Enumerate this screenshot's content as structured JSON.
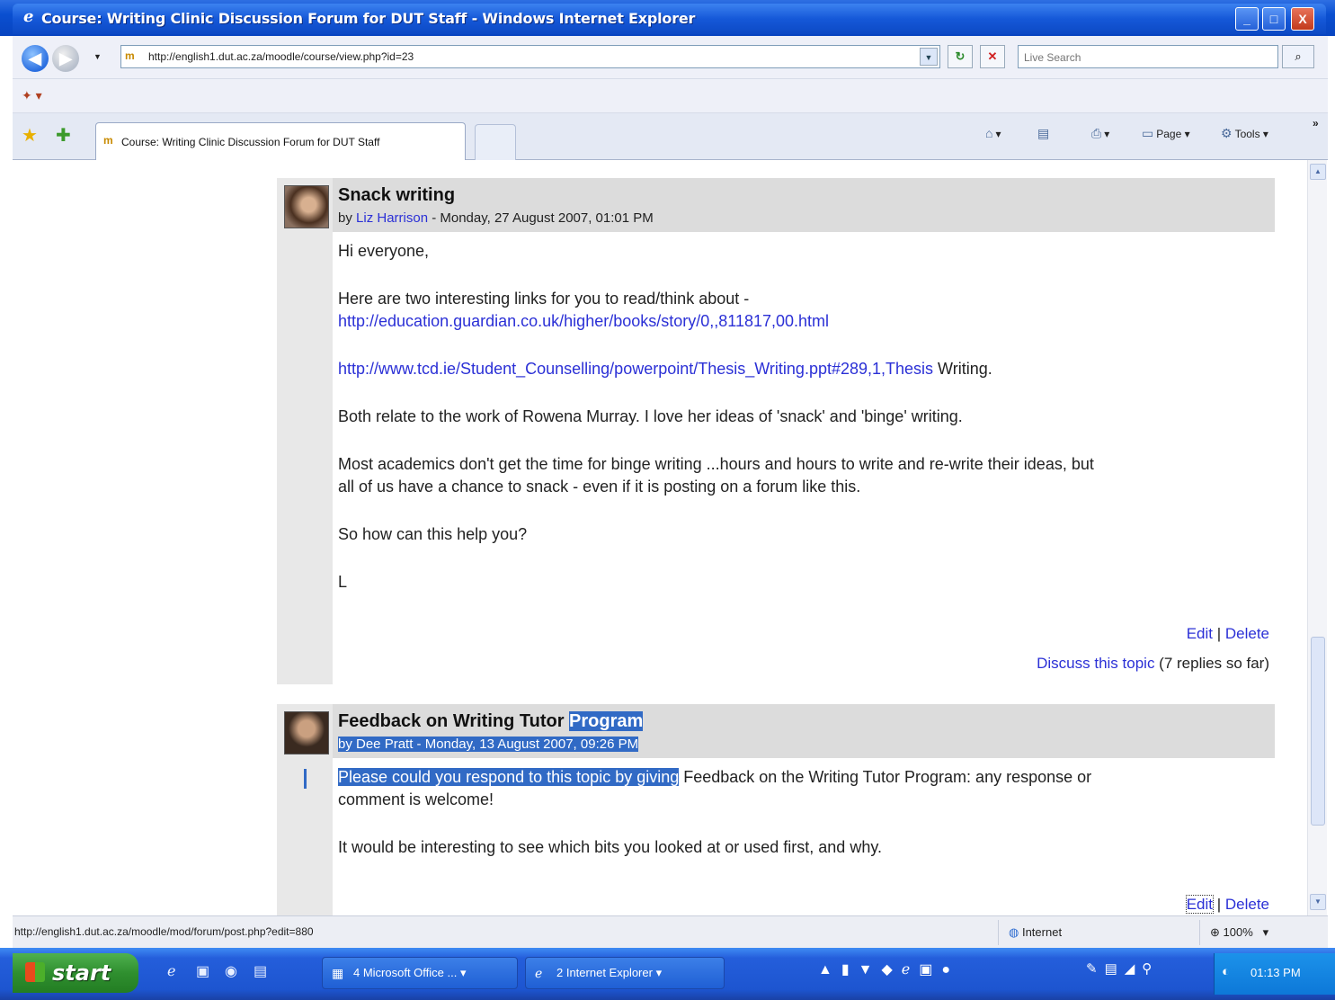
{
  "window": {
    "title": "Course: Writing Clinic Discussion Forum for DUT Staff - Windows Internet Explorer",
    "controls": {
      "minimize": "_",
      "maximize": "□",
      "close": "X"
    }
  },
  "addressbar": {
    "url": "http://english1.dut.ac.za/moodle/course/view.php?id=23",
    "search_placeholder": "Live Search"
  },
  "tab": {
    "label": "Course: Writing Clinic Discussion Forum for DUT Staff"
  },
  "commandbar": {
    "page": "Page",
    "tools": "Tools"
  },
  "posts": [
    {
      "title": "Snack writing",
      "by": "by ",
      "author": "Liz Harrison",
      "date": " - Monday, 27 August 2007, 01:01 PM",
      "greeting": "Hi everyone,",
      "line1": "Here are two interesting links for you to read/think about -",
      "link1": "http://education.guardian.co.uk/higher/books/story/0,,811817,00.html",
      "link2": "http://www.tcd.ie/Student_Counselling/powerpoint/Thesis_Writing.ppt#289,1,Thesis",
      "link2_tail": " Writing.",
      "para2": "Both relate to the work of Rowena Murray. I love her ideas of 'snack' and 'binge' writing.",
      "para3a": "Most academics don't get the time for binge writing ...hours and hours to write and re-write their ideas, but",
      "para3b": "all of us have a chance to snack - even if it is posting on a forum like this.",
      "para4": "So how can this help you?",
      "sign": "L",
      "edit": "Edit",
      "sep": " | ",
      "delete": "Delete",
      "discuss": "Discuss this topic",
      "replies": " (7 replies so far)"
    },
    {
      "title_a": "Feedback on Writing Tutor ",
      "title_b": "Program",
      "meta": "by Dee Pratt - Monday, 13 August 2007, 09:26 PM",
      "line1_sel": "Please could you respond to this topic by giving",
      "line1_rest": " Feedback on the Writing Tutor Program: any response or",
      "line2": "comment is welcome!",
      "para2": "It would be interesting to see which bits you looked at or used first, and why.",
      "edit": "Edit",
      "sep": " | ",
      "delete": "Delete"
    }
  ],
  "statusbar": {
    "url": "http://english1.dut.ac.za/moodle/mod/forum/post.php?edit=880",
    "zone": "Internet",
    "zoom": "100%"
  },
  "taskbar": {
    "start": "start",
    "task1": "4 Microsoft Office ...",
    "task2": "2 Internet Explorer",
    "clock": "01:13 PM"
  }
}
